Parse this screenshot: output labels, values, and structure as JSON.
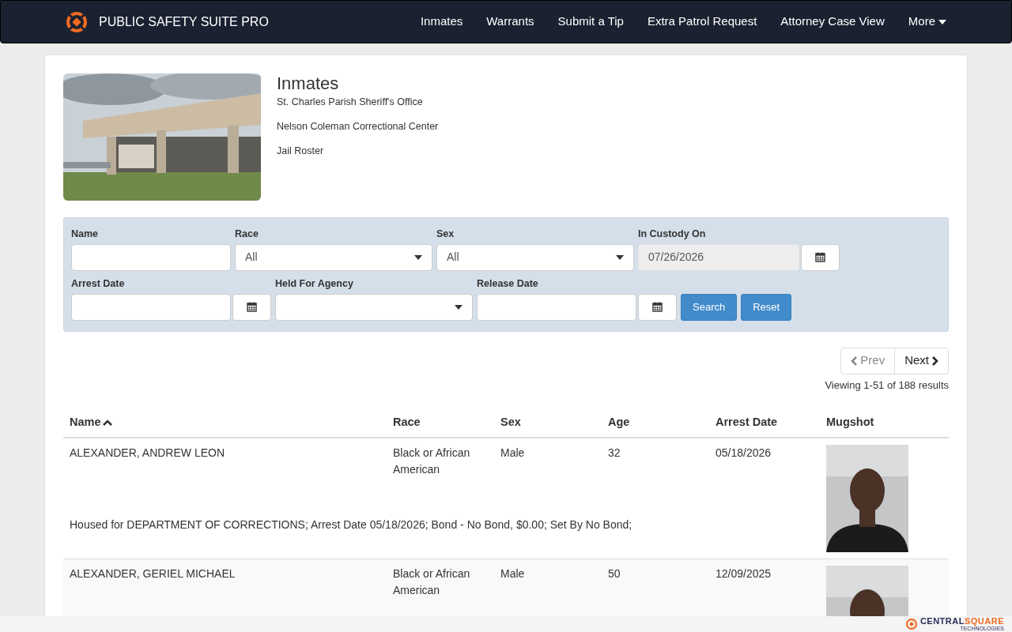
{
  "navbar": {
    "brand": "PUBLIC SAFETY SUITE PRO",
    "links": [
      {
        "label": "Inmates",
        "kind": "link"
      },
      {
        "label": "Warrants",
        "kind": "link"
      },
      {
        "label": "Submit a Tip",
        "kind": "link"
      },
      {
        "label": "Extra Patrol Request",
        "kind": "link"
      },
      {
        "label": "Attorney Case View",
        "kind": "link"
      },
      {
        "label": "More",
        "kind": "dropdown"
      }
    ]
  },
  "header": {
    "photo": {
      "kind": "picture"
    },
    "title": "Inmates",
    "lines": [
      "St. Charles Parish Sheriff's Office",
      "Nelson Coleman Correctional Center",
      "Jail Roster"
    ]
  },
  "filters": [
    [
      {
        "label": "Name",
        "kind": "text"
      },
      {
        "label": "Race",
        "kind": "select",
        "value": "All"
      },
      {
        "label": "Sex",
        "kind": "select",
        "value": "All"
      },
      {
        "label": "In Custody On",
        "kind": "date",
        "value": "07/26/2026",
        "readonly": true
      }
    ],
    [
      {
        "label": "Arrest Date",
        "kind": "date",
        "readonly": false
      },
      {
        "label": "Held For Agency",
        "kind": "select"
      },
      {
        "label": "Release Date",
        "kind": "date",
        "readonly": false
      }
    ]
  ],
  "buttons": [
    "Search",
    "Reset"
  ],
  "pagination": {
    "prev": {
      "label": "Prev",
      "disabled": true
    },
    "next": {
      "label": "Next",
      "disabled": false
    },
    "summary": "Viewing 1-51 of 188 results"
  },
  "table": {
    "columns": [
      {
        "label": "Name",
        "sorted": true
      },
      {
        "label": "Race",
        "sorted": false
      },
      {
        "label": "Sex",
        "sorted": false
      },
      {
        "label": "Age",
        "sorted": false
      },
      {
        "label": "Arrest Date",
        "sorted": false
      },
      {
        "label": "Mugshot",
        "sorted": false
      }
    ],
    "rows": [
      {
        "cells": [
          "ALEXANDER, ANDREW LEON",
          "Black or African American",
          "Male",
          "32",
          "05/18/2026"
        ],
        "note": "Housed for DEPARTMENT OF CORRECTIONS; Arrest Date 05/18/2026; Bond - No Bond, $0.00; Set By No Bond;",
        "mugshot": {
          "kind": "picture"
        }
      },
      {
        "cells": [
          "ALEXANDER, GERIEL MICHAEL",
          "Black or African American",
          "Male",
          "50",
          "12/09/2025"
        ],
        "mugshot": {
          "kind": "picture"
        }
      }
    ]
  },
  "footer": {
    "logo_parts": [
      "CENTRAL",
      "SQUARE"
    ],
    "tagline": "TECHNOLOGIES"
  }
}
